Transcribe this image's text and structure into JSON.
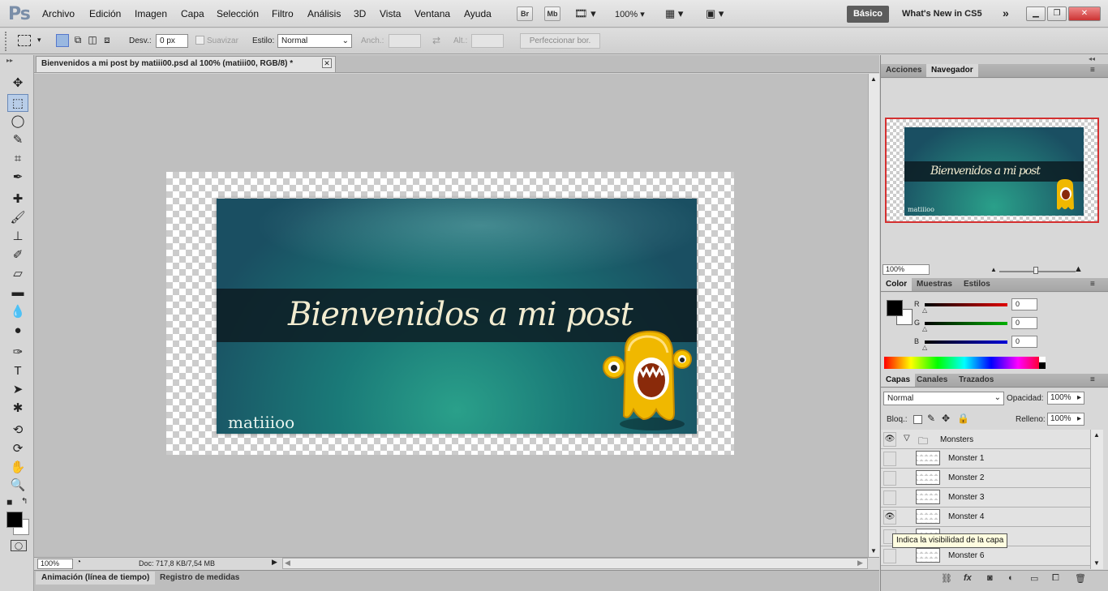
{
  "menubar": {
    "logo": "Ps",
    "items": [
      "Archivo",
      "Edición",
      "Imagen",
      "Capa",
      "Selección",
      "Filtro",
      "Análisis",
      "3D",
      "Vista",
      "Ventana",
      "Ayuda"
    ],
    "bridge_label": "Br",
    "minibridge_label": "Mb",
    "zoom": "100%",
    "workspace": "Básico",
    "whats_new": "What's New in CS5"
  },
  "options": {
    "desv_label": "Desv.:",
    "desv_value": "0 px",
    "suavizar_label": "Suavizar",
    "estilo_label": "Estilo:",
    "estilo_value": "Normal",
    "anch_label": "Anch.:",
    "alt_label": "Alt.:",
    "refine_label": "Perfeccionar bor."
  },
  "document": {
    "tab_title": "Bienvenidos a mi post by matiii00.psd al 100% (matiii00, RGB/8) *",
    "banner_title": "Bienvenidos a mi post",
    "banner_signature": "matiiioo",
    "zoom": "100%",
    "doc_info": "Doc: 717,8 KB/7,54 MB"
  },
  "bottom_tabs": [
    "Animación (línea de tiempo)",
    "Registro de medidas"
  ],
  "navigator": {
    "tabs": [
      "Acciones",
      "Navegador"
    ],
    "zoom": "100%"
  },
  "color_panel": {
    "tabs": [
      "Color",
      "Muestras",
      "Estilos"
    ],
    "channels": [
      {
        "label": "R",
        "value": "0",
        "color": "#e00000"
      },
      {
        "label": "G",
        "value": "0",
        "color": "#00b000"
      },
      {
        "label": "B",
        "value": "0",
        "color": "#0000d8"
      }
    ]
  },
  "layers_panel": {
    "tabs": [
      "Capas",
      "Canales",
      "Trazados"
    ],
    "blend_mode": "Normal",
    "opacity_label": "Opacidad:",
    "opacity_value": "100%",
    "lock_label": "Bloq.:",
    "fill_label": "Relleno:",
    "fill_value": "100%",
    "group": "Monsters",
    "layers": [
      {
        "name": "Monster 1",
        "visible": false
      },
      {
        "name": "Monster 2",
        "visible": false
      },
      {
        "name": "Monster 3",
        "visible": false
      },
      {
        "name": "Monster 4",
        "visible": true
      },
      {
        "name": "",
        "visible": false
      },
      {
        "name": "Monster 6",
        "visible": false
      }
    ],
    "tooltip": "Indica la visibilidad de la capa"
  },
  "colors": {
    "accent_red": "#d43030",
    "banner_teal": "#1a7a78"
  }
}
